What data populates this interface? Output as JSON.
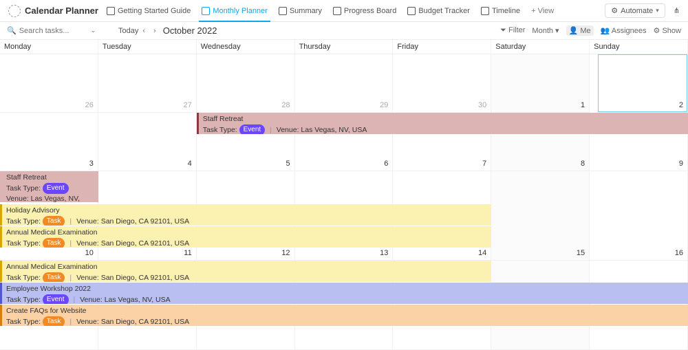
{
  "app": {
    "title": "Calendar Planner"
  },
  "tabs": [
    {
      "label": "Getting Started Guide"
    },
    {
      "label": "Monthly Planner",
      "active": true
    },
    {
      "label": "Summary"
    },
    {
      "label": "Progress Board"
    },
    {
      "label": "Budget Tracker"
    },
    {
      "label": "Timeline"
    }
  ],
  "add_view": "+ View",
  "automate": "Automate",
  "search_placeholder": "Search tasks...",
  "today": "Today",
  "month_label": "October 2022",
  "controls": {
    "filter": "Filter",
    "month": "Month",
    "me": "Me",
    "assignees": "Assignees",
    "show": "Show"
  },
  "day_headers": [
    "Monday",
    "Tuesday",
    "Wednesday",
    "Thursday",
    "Friday",
    "Saturday",
    "Sunday"
  ],
  "row0": [
    "26",
    "27",
    "28",
    "29",
    "30",
    "1",
    "2"
  ],
  "row1": [
    "3",
    "4",
    "5",
    "6",
    "7",
    "8",
    "9"
  ],
  "row2": [
    "10",
    "11",
    "12",
    "13",
    "14",
    "15",
    "16"
  ],
  "row3": [
    " ",
    " ",
    " ",
    " ",
    " ",
    " ",
    " "
  ],
  "labels": {
    "task_type": "Task Type:",
    "venue": "Venue:"
  },
  "venues": {
    "vegas": "Las Vegas, NV, USA",
    "sd": "San Diego, CA 92101, USA"
  },
  "tags": {
    "event": "Event",
    "task": "Task"
  },
  "events": {
    "staff_retreat": {
      "title": "Staff Retreat"
    },
    "holiday_advisory": {
      "title": "Holiday Advisory"
    },
    "medical": {
      "title": "Annual Medical Examination"
    },
    "workshop": {
      "title": "Employee Workshop 2022"
    },
    "faqs": {
      "title": "Create FAQs for Website"
    }
  }
}
